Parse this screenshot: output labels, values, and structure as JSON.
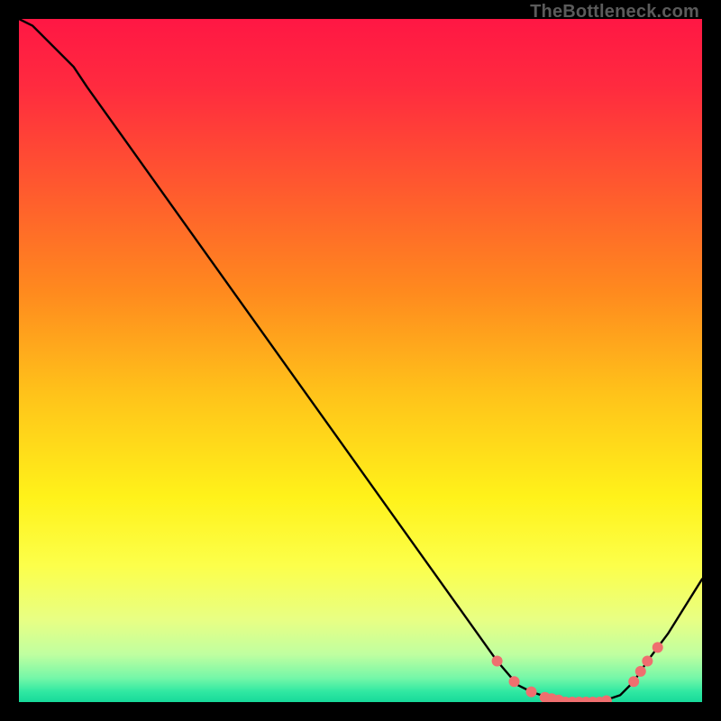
{
  "watermark": "TheBottleneck.com",
  "chart_data": {
    "type": "line",
    "title": "",
    "xlabel": "",
    "ylabel": "",
    "xlim": [
      0,
      100
    ],
    "ylim": [
      0,
      100
    ],
    "grid": false,
    "legend": false,
    "gradient_stops": [
      {
        "offset": 0.0,
        "color": "#ff1744"
      },
      {
        "offset": 0.1,
        "color": "#ff2b3f"
      },
      {
        "offset": 0.25,
        "color": "#ff5a2e"
      },
      {
        "offset": 0.4,
        "color": "#ff8a1e"
      },
      {
        "offset": 0.55,
        "color": "#ffc31a"
      },
      {
        "offset": 0.7,
        "color": "#fff21a"
      },
      {
        "offset": 0.8,
        "color": "#fcff4a"
      },
      {
        "offset": 0.88,
        "color": "#e8ff84"
      },
      {
        "offset": 0.93,
        "color": "#c0ffa0"
      },
      {
        "offset": 0.965,
        "color": "#74f7a8"
      },
      {
        "offset": 0.985,
        "color": "#2fe8a2"
      },
      {
        "offset": 1.0,
        "color": "#17d99a"
      }
    ],
    "series": [
      {
        "name": "bottleneck-curve",
        "color": "#000000",
        "x": [
          0,
          2,
          5,
          8,
          10,
          15,
          20,
          30,
          40,
          50,
          60,
          65,
          70,
          73,
          75,
          78,
          80,
          83,
          85,
          88,
          90,
          92,
          95,
          100
        ],
        "y": [
          100,
          99,
          96,
          93,
          90,
          83,
          76,
          62,
          48,
          34,
          20,
          13,
          6,
          2.5,
          1.5,
          0.5,
          0,
          0,
          0,
          1,
          3,
          6,
          10,
          18
        ]
      }
    ],
    "markers": {
      "name": "highlight-dots",
      "color": "#ef6f6f",
      "radius": 6,
      "points": [
        {
          "x": 70,
          "y": 6
        },
        {
          "x": 72.5,
          "y": 3
        },
        {
          "x": 75,
          "y": 1.5
        },
        {
          "x": 77,
          "y": 0.7
        },
        {
          "x": 78,
          "y": 0.5
        },
        {
          "x": 79,
          "y": 0.3
        },
        {
          "x": 80,
          "y": 0
        },
        {
          "x": 81,
          "y": 0
        },
        {
          "x": 82,
          "y": 0
        },
        {
          "x": 83,
          "y": 0
        },
        {
          "x": 84,
          "y": 0
        },
        {
          "x": 85,
          "y": 0
        },
        {
          "x": 86,
          "y": 0.2
        },
        {
          "x": 90,
          "y": 3
        },
        {
          "x": 91,
          "y": 4.5
        },
        {
          "x": 92,
          "y": 6
        },
        {
          "x": 93.5,
          "y": 8
        }
      ]
    }
  }
}
